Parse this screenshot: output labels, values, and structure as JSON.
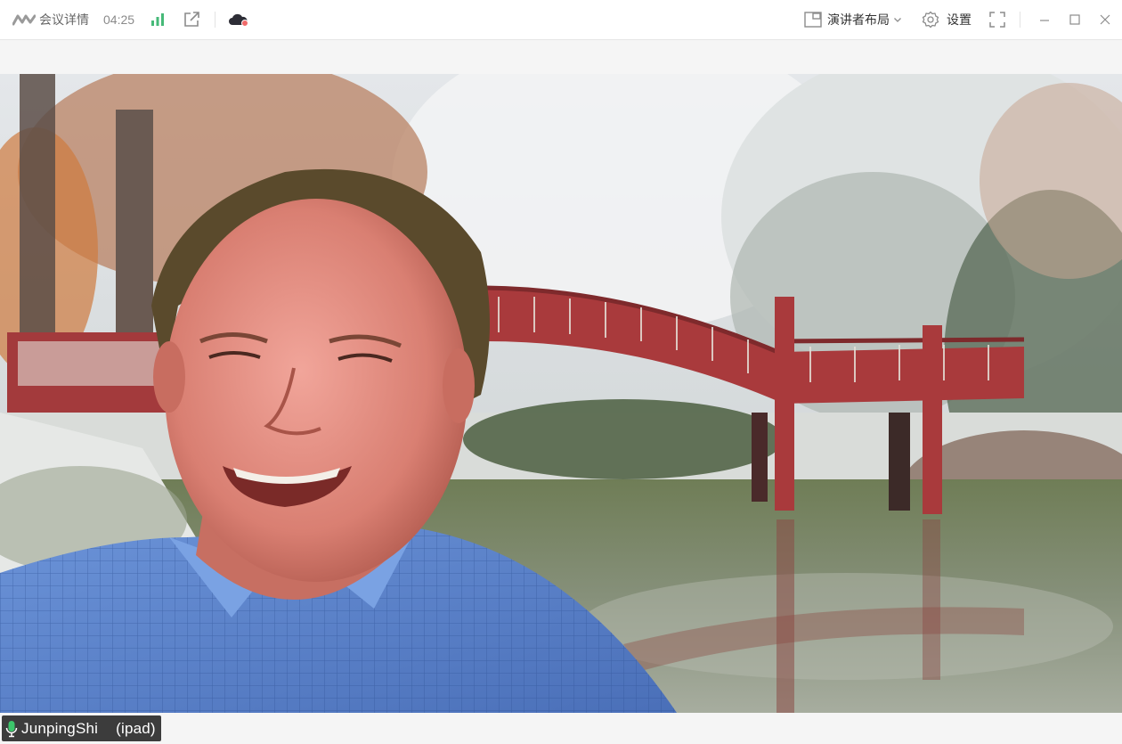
{
  "titlebar": {
    "meeting_title": "会议详情",
    "timer": "04:25",
    "icons": {
      "logo": "tencent-meeting-logo-icon",
      "signal": "signal-bars-icon",
      "share": "external-link-icon",
      "cloud": "cloud-recording-icon"
    },
    "layout_button_label": "演讲者布局",
    "settings_label": "设置",
    "colors": {
      "signal_green": "#46b978",
      "cloud_dot": "#f06a6a",
      "icon_gray": "#8c8c8c"
    }
  },
  "video": {
    "speaker_name": "JunpingShi",
    "speaker_device": "(ipad)",
    "mic_color": "#3cc66b"
  }
}
